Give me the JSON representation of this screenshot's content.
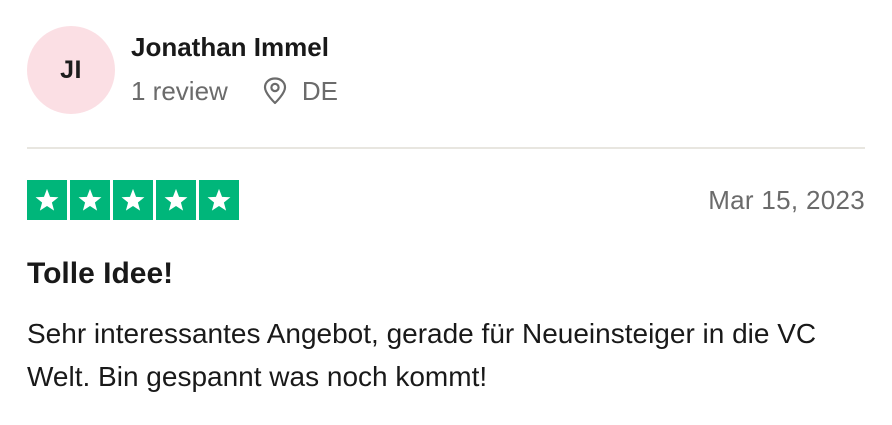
{
  "consumer": {
    "initials": "JI",
    "name": "Jonathan Immel",
    "review_count": "1 review",
    "country": "DE",
    "avatar_color": "#fbdfe4"
  },
  "review": {
    "rating_stars": 5,
    "rating_max": 5,
    "star_color": "#00b67a",
    "date": "Mar 15, 2023",
    "title": "Tolle Idee!",
    "text": "Sehr interessantes Angebot, gerade für Neueinsteiger in die VC Welt. Bin gespannt was noch kommt!"
  },
  "icons": {
    "location": "location-pin-icon",
    "star": "star-icon"
  }
}
